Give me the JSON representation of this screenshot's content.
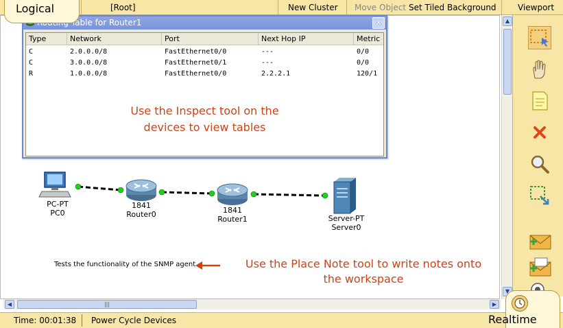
{
  "topbar": {
    "mode_tab": "Logical",
    "root": "[Root]",
    "new_cluster": "New Cluster",
    "move_object": "Move Object",
    "set_tiled_background": "Set Tiled Background",
    "viewport": "Viewport"
  },
  "routing_window": {
    "title": "Routing Table for Router1",
    "columns": [
      "Type",
      "Network",
      "Port",
      "Next Hop IP",
      "Metric"
    ],
    "rows": [
      [
        "C",
        "2.0.0.0/8",
        "FastEthernet0/0",
        "---",
        "0/0"
      ],
      [
        "C",
        "3.0.0.0/8",
        "FastEthernet0/1",
        "---",
        "0/0"
      ],
      [
        "R",
        "1.0.0.0/8",
        "FastEthernet0/0",
        "2.2.2.1",
        "120/1"
      ]
    ],
    "hint_line1": "Use the Inspect tool on the",
    "hint_line2": "devices to view tables"
  },
  "devices": {
    "pc": {
      "type": "PC-PT",
      "name": "PC0"
    },
    "router0": {
      "type": "1841",
      "name": "Router0"
    },
    "router1": {
      "type": "1841",
      "name": "Router1"
    },
    "server": {
      "type": "Server-PT",
      "name": "Server0"
    }
  },
  "workspace": {
    "note": "Tests the functionality of the SNMP agent",
    "place_note_hint_line1": "Use the Place Note tool to write notes onto",
    "place_note_hint_line2": "the workspace"
  },
  "tools": [
    "select-tool",
    "move-layout-tool",
    "place-note-tool",
    "delete-tool",
    "inspect-tool",
    "resize-shape-tool",
    "add-simple-pdu-tool",
    "add-complex-pdu-tool"
  ],
  "status": {
    "time": "Time: 00:01:38",
    "power_cycle": "Power Cycle Devices",
    "mode": "Realtime"
  },
  "colors": {
    "accent_bar": "#f7e6a6",
    "hint_text": "#c8451a",
    "window_title": "#7a94db",
    "link_dot": "#22cc22"
  }
}
